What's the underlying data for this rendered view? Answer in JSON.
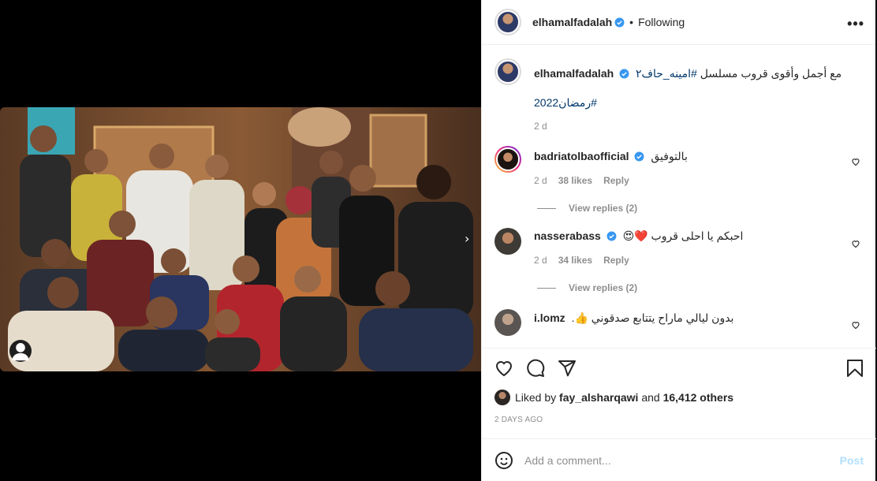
{
  "header": {
    "username": "elhamalfadalah",
    "separator": "•",
    "follow_status": "Following",
    "more_label": "•••"
  },
  "caption": {
    "username": "elhamalfadalah",
    "text": "مع أجمل وأقوى قروب مسلسل",
    "hashtag1": "#امينه_حاف٢",
    "hashtag2": "#رمضان2022",
    "time": "2 d"
  },
  "comments": [
    {
      "username": "badriatolbaofficial",
      "text": "بالتوفيق",
      "time": "2 d",
      "likes": "38 likes",
      "reply": "Reply",
      "view_replies": "View replies (2)"
    },
    {
      "username": "nasserabass",
      "text": "احبكم يا احلى قروب",
      "emoji": "❤️😍",
      "time": "2 d",
      "likes": "34 likes",
      "reply": "Reply",
      "view_replies": "View replies (2)"
    },
    {
      "username": "i.lomz",
      "text": "بدون ليالي ماراح يتتابع صدقوني",
      "emoji": "👍."
    }
  ],
  "likes": {
    "prefix": "Liked by",
    "user": "fay_alsharqawi",
    "joiner": "and",
    "others": "16,412 others"
  },
  "date_label": "2 DAYS AGO",
  "add_comment": {
    "placeholder": "Add a comment...",
    "post_label": "Post"
  },
  "icons": {
    "tag": "user-tag-icon",
    "like": "heart-icon",
    "comment": "comment-icon",
    "share": "share-icon",
    "save": "bookmark-icon",
    "emoji": "emoji-icon",
    "verified": "verified-badge-icon",
    "next": "chevron-right-icon"
  },
  "colors": {
    "verified": "#3897f0",
    "link": "#00376b",
    "post_disabled": "#b2dffc",
    "muted": "#8e8e8e"
  }
}
